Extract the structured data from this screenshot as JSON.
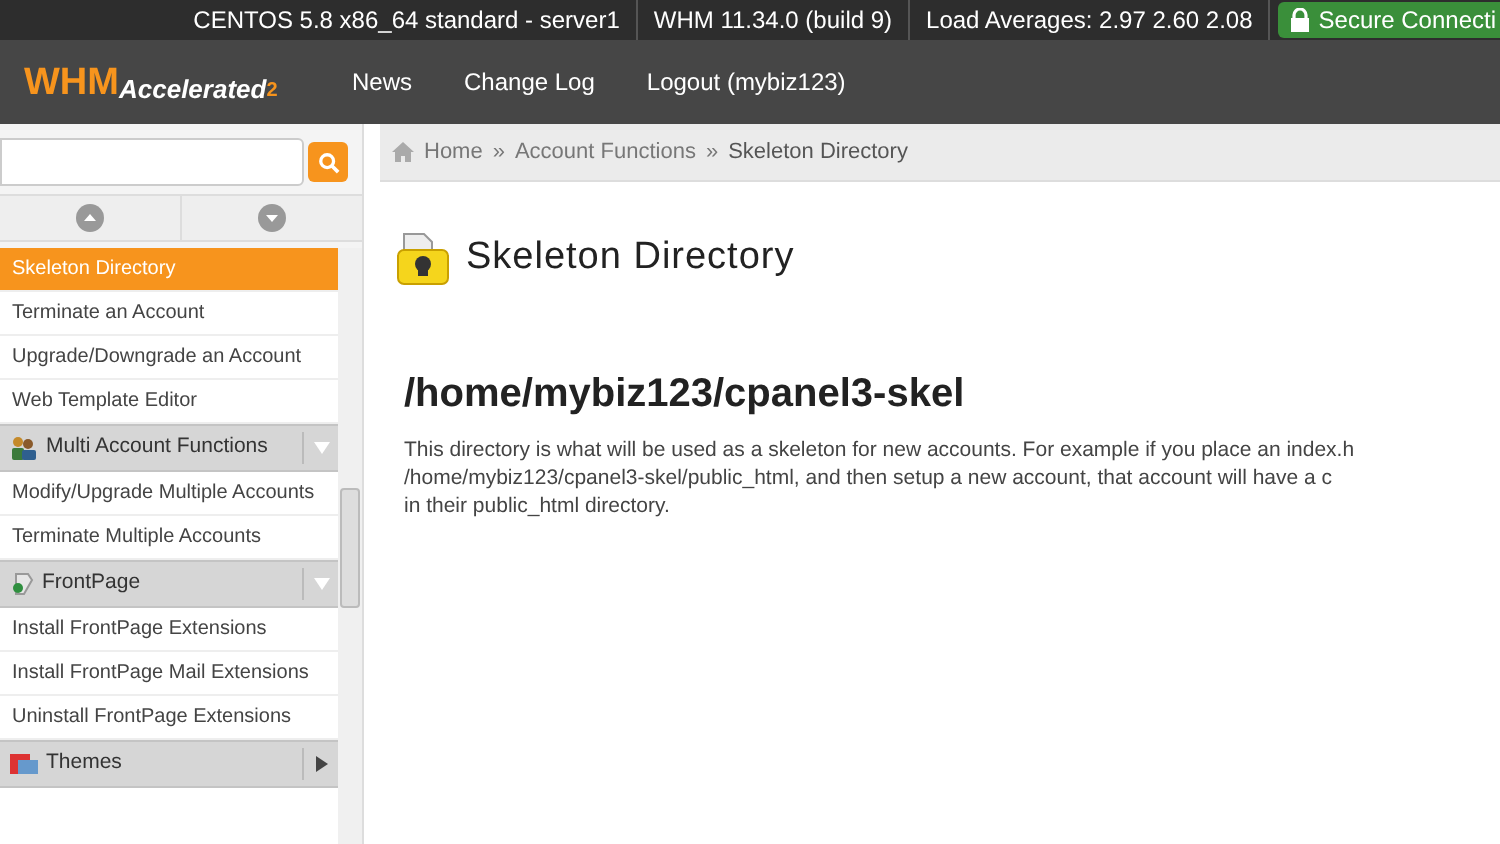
{
  "top_bar": {
    "items": [
      "CENTOS 5.8 x86_64 standard - server1",
      "WHM 11.34.0 (build 9)",
      "Load Averages: 2.97 2.60 2.08"
    ],
    "secure_badge": "Secure Connecti"
  },
  "header": {
    "logo": {
      "main": "WHM",
      "sub": "Accelerated",
      "version": "2"
    },
    "nav": [
      "News",
      "Change Log",
      "Logout (mybiz123)"
    ]
  },
  "sidebar": {
    "items": [
      {
        "kind": "item",
        "label": "Skeleton Directory",
        "selected": true
      },
      {
        "kind": "item",
        "label": "Terminate an Account",
        "selected": false
      },
      {
        "kind": "item",
        "label": "Upgrade/Downgrade an Account",
        "selected": false
      },
      {
        "kind": "item",
        "label": "Web Template Editor",
        "selected": false
      },
      {
        "kind": "section",
        "label": "Multi Account Functions",
        "expanded": true
      },
      {
        "kind": "item",
        "label": "Modify/Upgrade Multiple Accounts",
        "selected": false
      },
      {
        "kind": "item",
        "label": "Terminate Multiple Accounts",
        "selected": false
      },
      {
        "kind": "section",
        "label": "FrontPage",
        "expanded": true
      },
      {
        "kind": "item",
        "label": "Install FrontPage Extensions",
        "selected": false
      },
      {
        "kind": "item",
        "label": "Install FrontPage Mail Extensions",
        "selected": false
      },
      {
        "kind": "item",
        "label": "Uninstall FrontPage Extensions",
        "selected": false
      },
      {
        "kind": "section",
        "label": "Themes",
        "expanded": false
      }
    ]
  },
  "breadcrumb": [
    {
      "kind": "link",
      "text": "Home"
    },
    {
      "kind": "separator",
      "text": "»"
    },
    {
      "kind": "link",
      "text": "Account Functions"
    },
    {
      "kind": "separator",
      "text": "»"
    },
    {
      "kind": "current",
      "text": "Skeleton Directory"
    }
  ],
  "page": {
    "title": "Skeleton Directory",
    "path": "/home/mybiz123/cpanel3-skel",
    "paragraph_lines": [
      "This directory is what will be used as a skeleton for new accounts. For example if you place an index.h",
      "/home/mybiz123/cpanel3-skel/public_html, and then setup a new account, that account will have a c",
      "in their public_html directory."
    ]
  }
}
